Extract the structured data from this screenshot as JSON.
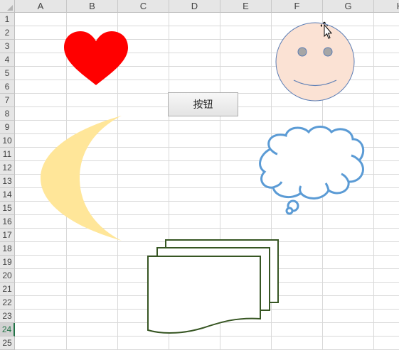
{
  "columns": [
    "A",
    "B",
    "C",
    "D",
    "E",
    "F",
    "G",
    "H"
  ],
  "rows": [
    "1",
    "2",
    "3",
    "4",
    "5",
    "6",
    "7",
    "8",
    "9",
    "10",
    "11",
    "12",
    "13",
    "14",
    "15",
    "16",
    "17",
    "18",
    "19",
    "20",
    "21",
    "22",
    "23",
    "24",
    "25"
  ],
  "active_row": "24",
  "button": {
    "label": "按钮"
  },
  "shapes": {
    "heart": {
      "fill": "#ff0000"
    },
    "smiley": {
      "fill": "#fbe2d4",
      "stroke": "#5b7db5",
      "eyes": "#a6a6a6"
    },
    "moon": {
      "fill": "#ffe699"
    },
    "cloud_callout": {
      "stroke": "#5b9bd5",
      "fill": "#ffffff"
    },
    "multidocument": {
      "stroke": "#375623",
      "fill": "#ffffff"
    }
  },
  "cursor_icon": "move-arrow-cursor-icon"
}
